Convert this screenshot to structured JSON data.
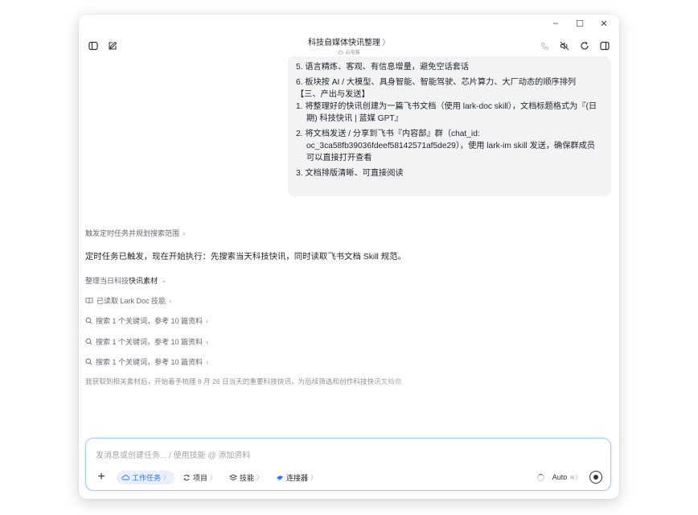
{
  "window": {
    "controls": {
      "minimize": "–",
      "maximize": "☐",
      "close": "✕"
    }
  },
  "header": {
    "title": "科技自媒体快讯整理",
    "title_chevron": "〉",
    "subtitle": "云电脑"
  },
  "bubble": {
    "lines": [
      "5. 语言精炼、客观、有信息增量，避免空话套话",
      "6. 板块按 AI / 大模型、具身智能、智能驾驶、芯片算力、大厂动态的顺序排列",
      "【三、产出与发送】",
      "1. 将整理好的快讯创建为一篇飞书文档（使用 lark-doc skill），文档标题格式为『(日期) 科技快讯 | 蓝媒 GPT』",
      "2. 将文档发送 / 分享到飞书『内容部』群（chat_id: oc_3ca58fb39036fdeef58142571af5de29），使用 lark-im skill 发送，确保群成员可以直接打开查看",
      "3. 文档排版清晰、可直接阅读"
    ]
  },
  "steps": {
    "trigger": "触发定时任务并规划搜索范围",
    "main_text": "定时任务已触发，现在开始执行：先搜索当天科技快讯，同时读取飞书文档 Skill 规范。",
    "organize_prefix": "整理当日科技",
    "organize_bold": "快讯素材",
    "read_skill": "已读取 Lark Doc 技能",
    "search_1": "搜索 1 个关键词，参考 10 篇资料",
    "search_2": "搜索 1 个关键词，参考 10 篇资料",
    "search_3": "搜索 1 个关键词，参考 10 篇资料",
    "progress": "我获取到相关素材后，开始着手梳理 8 月 26 日当天的重要科技快讯，为后续筛选和创作科技快讯文档做"
  },
  "composer": {
    "placeholder": "发消息或创建任务... / 使用技能 @ 添加资料",
    "chips": {
      "work_task": "工作任务",
      "project": "项目",
      "skills": "技能",
      "connector": "连接器"
    },
    "model": "Auto"
  },
  "colors": {
    "accent": "#3370ff",
    "bubble_bg": "#f2f3f5",
    "border": "#a9c7f3"
  }
}
